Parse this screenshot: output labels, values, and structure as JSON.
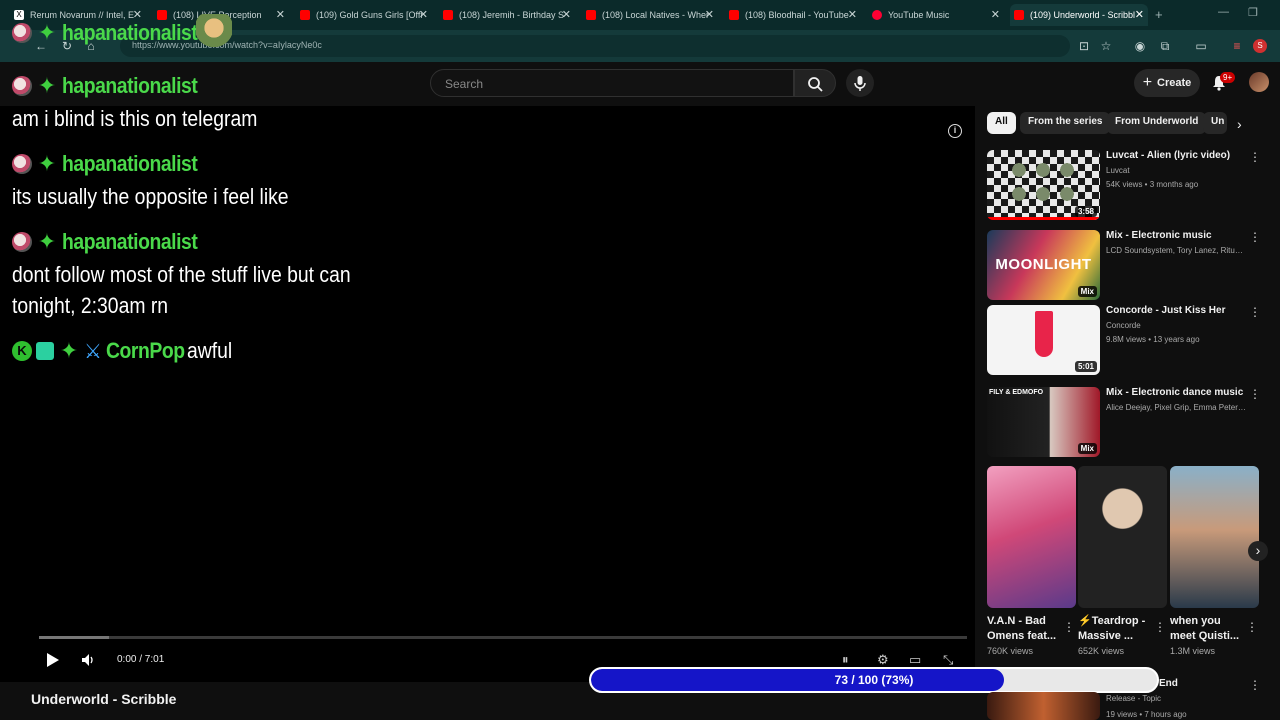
{
  "browser": {
    "tabs": [
      {
        "label": "Rerum Novarum // Intel, E",
        "color": "#000000"
      },
      {
        "label": "(108) LIVE Perception",
        "color": "#ff0000"
      },
      {
        "label": "(109) Gold Guns Girls [Offi",
        "color": "#ff0000"
      },
      {
        "label": "(108) Jeremih - Birthday S",
        "color": "#ff0000"
      },
      {
        "label": "(108) Local Natives - Wher",
        "color": "#ff0000"
      },
      {
        "label": "(108) Bloodhail - YouTube",
        "color": "#ff0000"
      },
      {
        "label": "YouTube Music",
        "color": "#ff0033"
      },
      {
        "label": "(109) Underworld - Scribbl",
        "color": "#ff0000"
      }
    ],
    "url": "https://www.youtube.com/watch?v=aIylacyNe0c",
    "profile_letter": "S"
  },
  "header": {
    "search_placeholder": "Search",
    "create_label": "Create",
    "notif_count": "9+"
  },
  "chat": [
    {
      "name": "hapanationalist",
      "message": "am i blind is this on telegram"
    },
    {
      "name": "hapanationalist",
      "message": "its usually the opposite i feel like"
    },
    {
      "name": "hapanationalist",
      "message_line1": "dont follow most of the stuff live but can",
      "message_line2": "tonight, 2:30am rn"
    },
    {
      "name": "CornPop",
      "message": "awful"
    }
  ],
  "top_chat_name": "hapanationalist",
  "player": {
    "time": "0:00 / 7:01",
    "title": "Underworld - Scribble"
  },
  "loader": {
    "text": "73 / 100 (73%)",
    "fraction": 0.73
  },
  "chips": [
    "All",
    "From the series",
    "From Underworld",
    "Un"
  ],
  "recommendations": [
    {
      "title": "Luvcat - Alien (lyric video)",
      "channel": "Luvcat",
      "meta": "54K views • 3 months ago",
      "duration": "3:58"
    },
    {
      "title": "Mix - Electronic music",
      "channel": "LCD Soundsystem, Tory Lanez, Rituals of...",
      "meta": "",
      "duration": "Mix"
    },
    {
      "title": "Concorde - Just Kiss Her",
      "channel": "Concorde",
      "meta": "9.8M views • 13 years ago",
      "duration": "5:01"
    },
    {
      "title": "Mix - Electronic dance music",
      "channel": "Alice Deejay, Pixel Grip, Emma Peters, an...",
      "meta": "",
      "duration": "Mix"
    }
  ],
  "shorts": [
    {
      "title": "V.A.N - Bad Omens feat...",
      "views": "760K views"
    },
    {
      "title": "⚡Teardrop - Massive ...",
      "views": "652K views"
    },
    {
      "title": "when you meet Quisti...",
      "views": "1.3M views"
    }
  ],
  "bottom_rec": {
    "title": "End",
    "channel": "Release - Topic",
    "meta": "19 views • 7 hours ago"
  }
}
